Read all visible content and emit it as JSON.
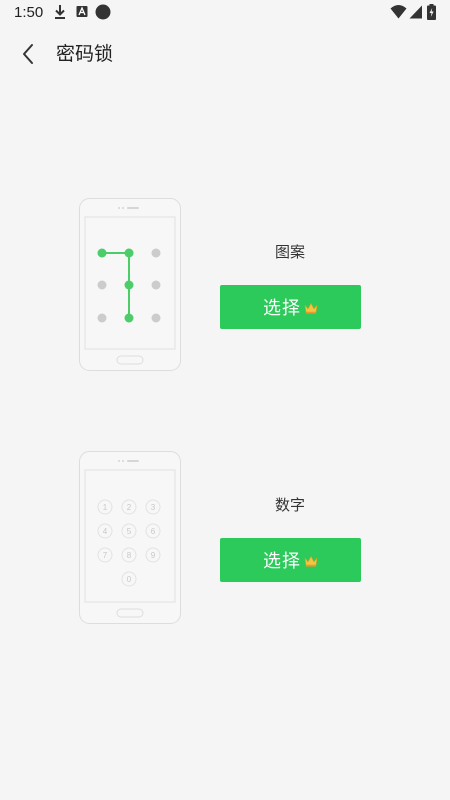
{
  "status_bar": {
    "time": "1:50",
    "icons": [
      "download-icon",
      "font-a-icon",
      "circle-dot-icon",
      "wifi-icon",
      "cellular-icon",
      "battery-icon"
    ]
  },
  "header": {
    "title": "密码锁",
    "back_icon": "chevron-left-icon"
  },
  "options": [
    {
      "label": "图案",
      "button_label": "选择",
      "badge_icon": "crown-icon"
    },
    {
      "label": "数字",
      "button_label": "选择",
      "badge_icon": "crown-icon"
    }
  ],
  "pin_keys": [
    "1",
    "2",
    "3",
    "4",
    "5",
    "6",
    "7",
    "8",
    "9",
    "0"
  ],
  "colors": {
    "accent": "#2cc95b",
    "pattern_active": "#4ccd6a",
    "pattern_inactive": "#cccccc",
    "background": "#f5f5f5"
  }
}
